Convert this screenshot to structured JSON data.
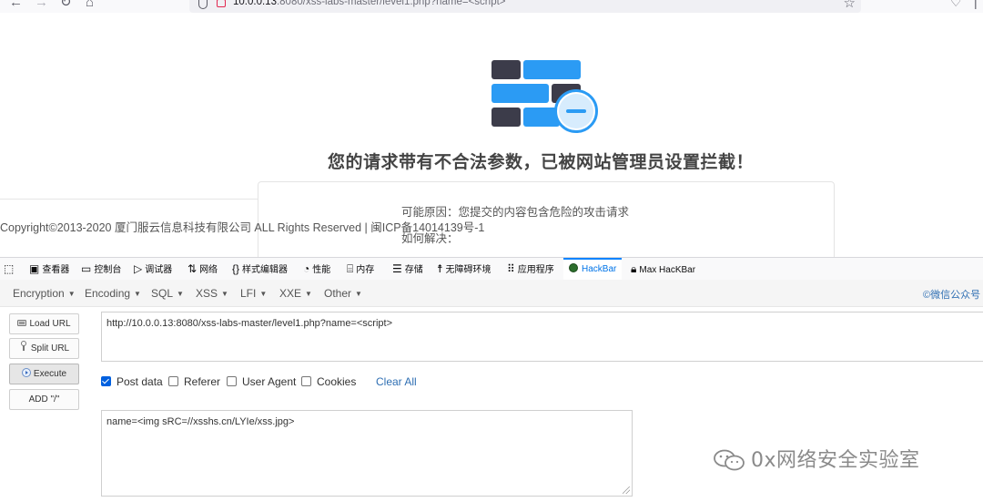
{
  "browser": {
    "url_host": "10.0.0.13",
    "url_rest": ":8080/xss-labs-master/level1.php?name=<script>"
  },
  "blocked_page": {
    "title": "您的请求带有不合法参数，已被网站管理员设置拦截！",
    "reason": "可能原因：您提交的内容包含危险的攻击请求",
    "howto": "如何解决：",
    "copyright": "Copyright©2013-2020 厦门服云信息科技有限公司 ALL Rights Reserved | 闽ICP备14014139号-1",
    "colors": {
      "brick_blue": "#2b9bf4",
      "brick_dark": "#3c3c4a"
    }
  },
  "devtools": {
    "tabs": [
      {
        "icon": "inspector-icon",
        "label": ""
      },
      {
        "icon": "chip-icon",
        "label": "查看器"
      },
      {
        "icon": "console-icon",
        "label": "控制台"
      },
      {
        "icon": "debugger-icon",
        "label": "调试器"
      },
      {
        "icon": "network-icon",
        "label": "网络"
      },
      {
        "icon": "braces-icon",
        "label": "样式编辑器"
      },
      {
        "icon": "performance-icon",
        "label": "性能"
      },
      {
        "icon": "memory-icon",
        "label": "内存"
      },
      {
        "icon": "storage-icon",
        "label": "存储"
      },
      {
        "icon": "accessibility-icon",
        "label": "无障碍环境"
      },
      {
        "icon": "grid-icon",
        "label": "应用程序"
      },
      {
        "icon": "hackbar-icon",
        "label": "HackBar"
      },
      {
        "icon": "lock-icon",
        "label": "Max HacKBar"
      }
    ],
    "active_tab": "HackBar",
    "accent": "#0a84ff"
  },
  "hackbar": {
    "menu": [
      "Encryption",
      "Encoding",
      "SQL",
      "XSS",
      "LFI",
      "XXE",
      "Other"
    ],
    "wechat": "©微信公众号",
    "buttons": {
      "load_url": "Load URL",
      "split_url": "Split URL",
      "execute": "Execute",
      "add_slash": "ADD \"/\""
    },
    "url_value": "http://10.0.0.13:8080/xss-labs-master/level1.php?name=<script>",
    "options": {
      "post_data": {
        "label": "Post data",
        "checked": true
      },
      "referer": {
        "label": "Referer",
        "checked": false
      },
      "user_agent": {
        "label": "User Agent",
        "checked": false
      },
      "cookies": {
        "label": "Cookies",
        "checked": false
      }
    },
    "clear_all": "Clear All",
    "post_value": "name=<img sRC=//xsshs.cn/LYIe/xss.jpg>"
  },
  "watermark": "0x网络安全实验室"
}
